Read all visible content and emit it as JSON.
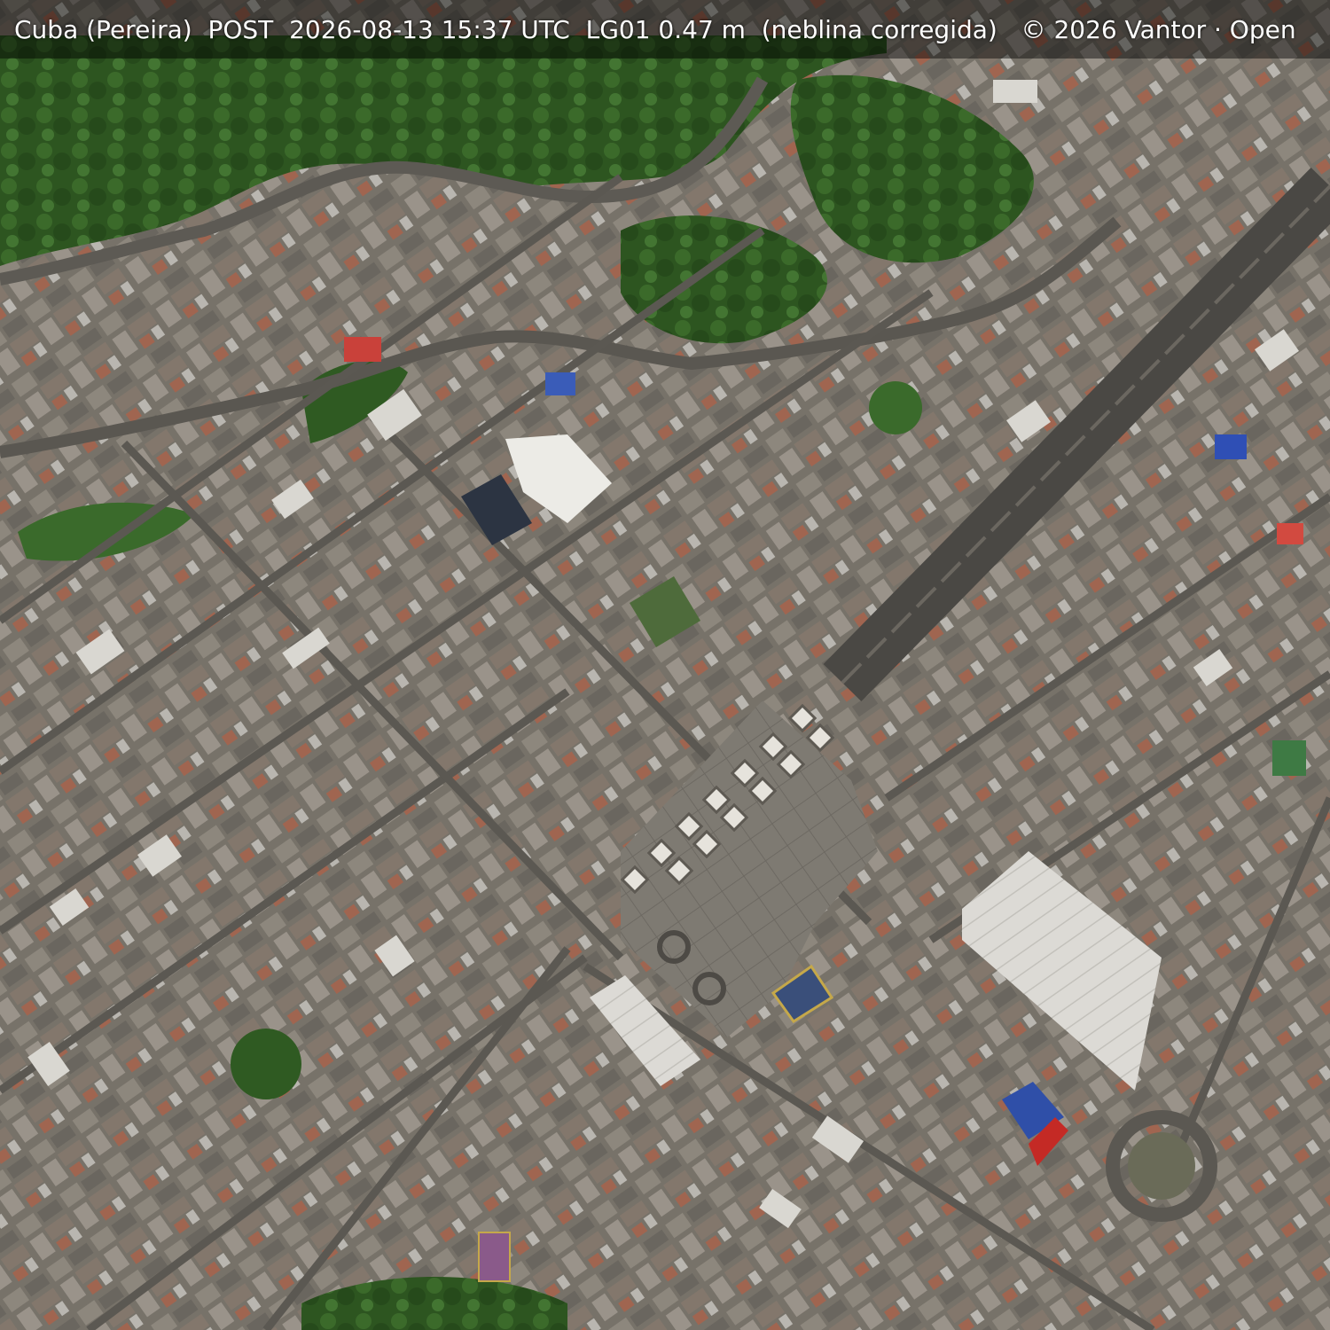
{
  "image": {
    "kind": "satellite-image",
    "description_colors": {
      "forest": "#2f5a22",
      "urban_roof": "#7a766e",
      "road": "#55524d",
      "plaza": "#8c877c"
    }
  },
  "caption": {
    "text": "Cuba (Pereira)  POST  2026-08-13 15:37 UTC  LG01 0.47 m  (neblina corregida)   © 2026 Vantor · Open"
  }
}
